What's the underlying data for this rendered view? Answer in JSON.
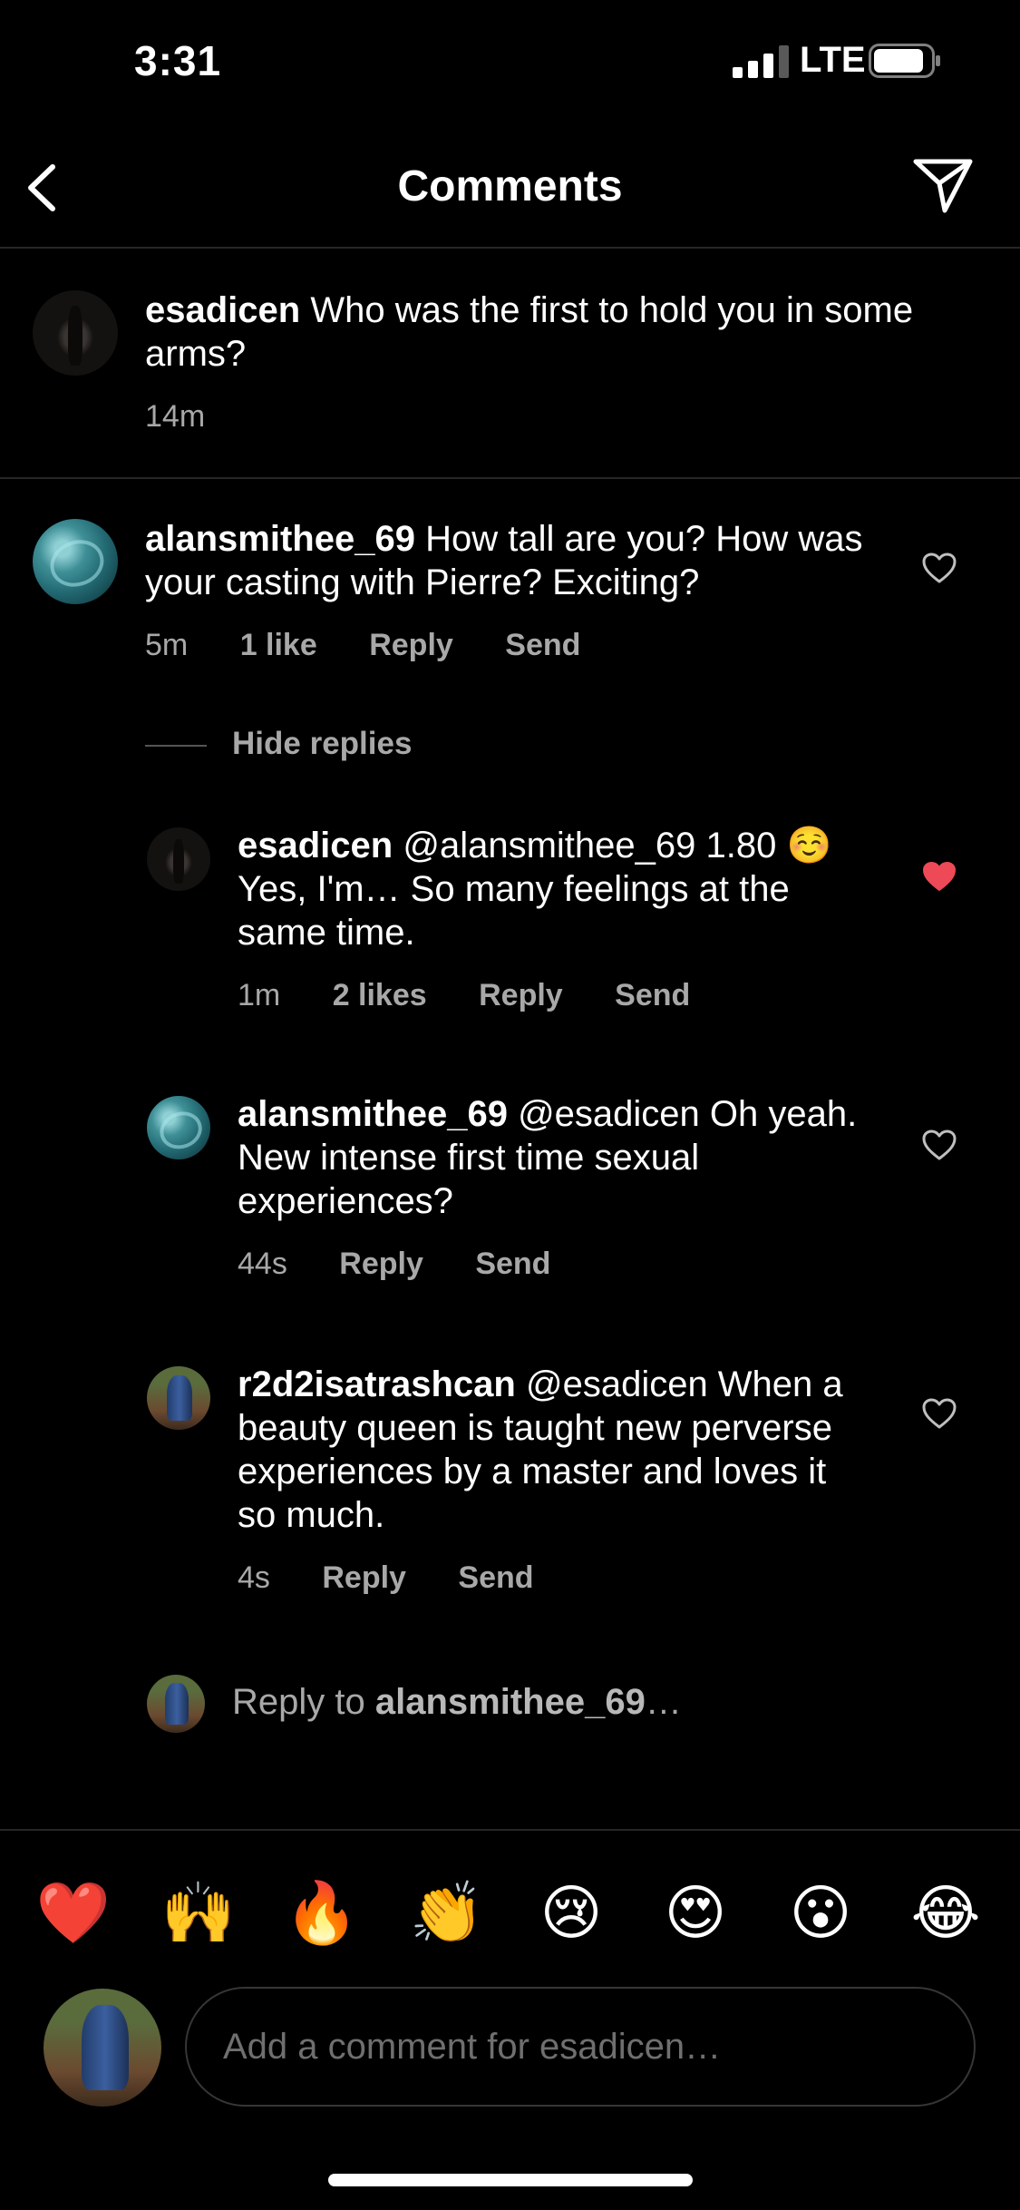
{
  "status_bar": {
    "time": "3:31",
    "network": "LTE"
  },
  "header": {
    "title": "Comments",
    "back_icon": "chevron-left-icon",
    "send_icon": "paper-plane-icon"
  },
  "caption": {
    "username": "esadicen",
    "text": "Who was the first to hold you in some arms?",
    "time": "14m"
  },
  "comments": [
    {
      "username": "alansmithee_69",
      "text": "How tall are you? How was your casting with Pierre? Exciting?",
      "time": "5m",
      "likes": "1 like",
      "reply_label": "Reply",
      "send_label": "Send",
      "liked": false
    }
  ],
  "hide_replies_label": "Hide replies",
  "replies": [
    {
      "username": "esadicen",
      "text": "@alansmithee_69 1.80 ☺️ Yes, I'm… So many feelings at the same time.",
      "time": "1m",
      "likes": "2 likes",
      "reply_label": "Reply",
      "send_label": "Send",
      "liked": true,
      "heart_color": "#ed4956"
    },
    {
      "username": "alansmithee_69",
      "text": "@esadicen Oh yeah. New intense first time sexual experiences?",
      "time": "44s",
      "reply_label": "Reply",
      "send_label": "Send",
      "liked": false
    },
    {
      "username": "r2d2isatrashcan",
      "text": "@esadicen When a beauty queen is taught new perverse experiences by a master and loves it so much.",
      "time": "4s",
      "reply_label": "Reply",
      "send_label": "Send",
      "liked": false
    }
  ],
  "reply_to": {
    "prefix": "Reply to",
    "username": "alansmithee_69",
    "suffix": "…"
  },
  "emojis": [
    "❤️",
    "🙌",
    "🔥",
    "👏",
    "😢",
    "😍",
    "😮",
    "😂"
  ],
  "composer": {
    "placeholder": "Add a comment for esadicen…"
  }
}
